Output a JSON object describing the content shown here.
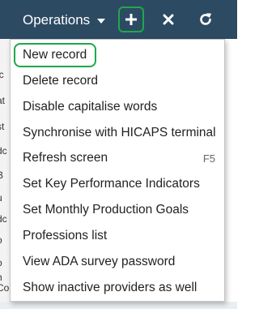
{
  "toolbar": {
    "operations_label": "Operations",
    "icons": [
      "chevron-down-icon",
      "plus-icon",
      "close-icon",
      "refresh-icon"
    ]
  },
  "background_fragments": [
    "ic",
    "at",
    "st",
    "dc",
    "B",
    "u",
    "dc",
    "o",
    "o",
    "h",
    "Co"
  ],
  "menu": {
    "items": [
      {
        "label": "New record",
        "shortcut": ""
      },
      {
        "label": "Delete record",
        "shortcut": ""
      },
      {
        "label": "Disable capitalise words",
        "shortcut": ""
      },
      {
        "label": "Synchronise with HICAPS terminal",
        "shortcut": ""
      },
      {
        "label": "Refresh screen",
        "shortcut": "F5"
      },
      {
        "label": "Set Key Performance Indicators",
        "shortcut": ""
      },
      {
        "label": "Set Monthly Production Goals",
        "shortcut": ""
      },
      {
        "label": "Professions list",
        "shortcut": ""
      },
      {
        "label": "View ADA survey password",
        "shortcut": ""
      },
      {
        "label": "Show inactive providers as well",
        "shortcut": ""
      }
    ]
  },
  "colors": {
    "toolbar_bg": "#2d4a63",
    "highlight_green": "#1fa84a",
    "menu_text": "#222222"
  }
}
